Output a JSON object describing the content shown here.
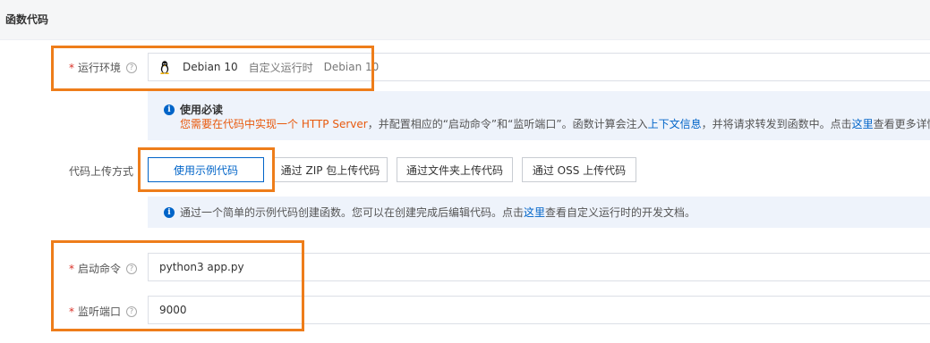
{
  "section": {
    "title": "函数代码"
  },
  "runtime": {
    "label": "运行环境",
    "required_mark": "*",
    "help_icon": "question-circle-icon",
    "icon": "linux-penguin-icon",
    "value": "Debian 10",
    "runtime_type": "自定义运行时",
    "runtime_os": "Debian 10"
  },
  "usage_notice": {
    "icon": "info-circle-icon",
    "title": "使用必读",
    "part1": "您需要在代码中实现一个 HTTP Server",
    "part2": "，并配置相应的“启动命令”和“监听端口”。函数计算会注入",
    "link1": "上下文信息",
    "part3": "，并将请求转发到函数中。点击",
    "link2": "这里",
    "part4": "查看更多详情。"
  },
  "upload": {
    "label": "代码上传方式",
    "options": [
      "使用示例代码",
      "通过 ZIP 包上传代码",
      "通过文件夹上传代码",
      "通过 OSS 上传代码"
    ],
    "selected": "使用示例代码"
  },
  "upload_notice": {
    "icon": "info-circle-icon",
    "part1": "通过一个简单的示例代码创建函数。您可以在创建完成后编辑代码。点击",
    "link": "这里",
    "part2": "查看自定义运行时的开发文档。"
  },
  "start_command": {
    "label": "启动命令",
    "required_mark": "*",
    "help_icon": "question-circle-icon",
    "value": "python3 app.py"
  },
  "listen_port": {
    "label": "监听端口",
    "required_mark": "*",
    "help_icon": "question-circle-icon",
    "value": "9000"
  },
  "colors": {
    "accent": "#0064c8",
    "highlight": "#ee7d1a",
    "warning_text": "#e8590c",
    "required": "#d93026"
  }
}
